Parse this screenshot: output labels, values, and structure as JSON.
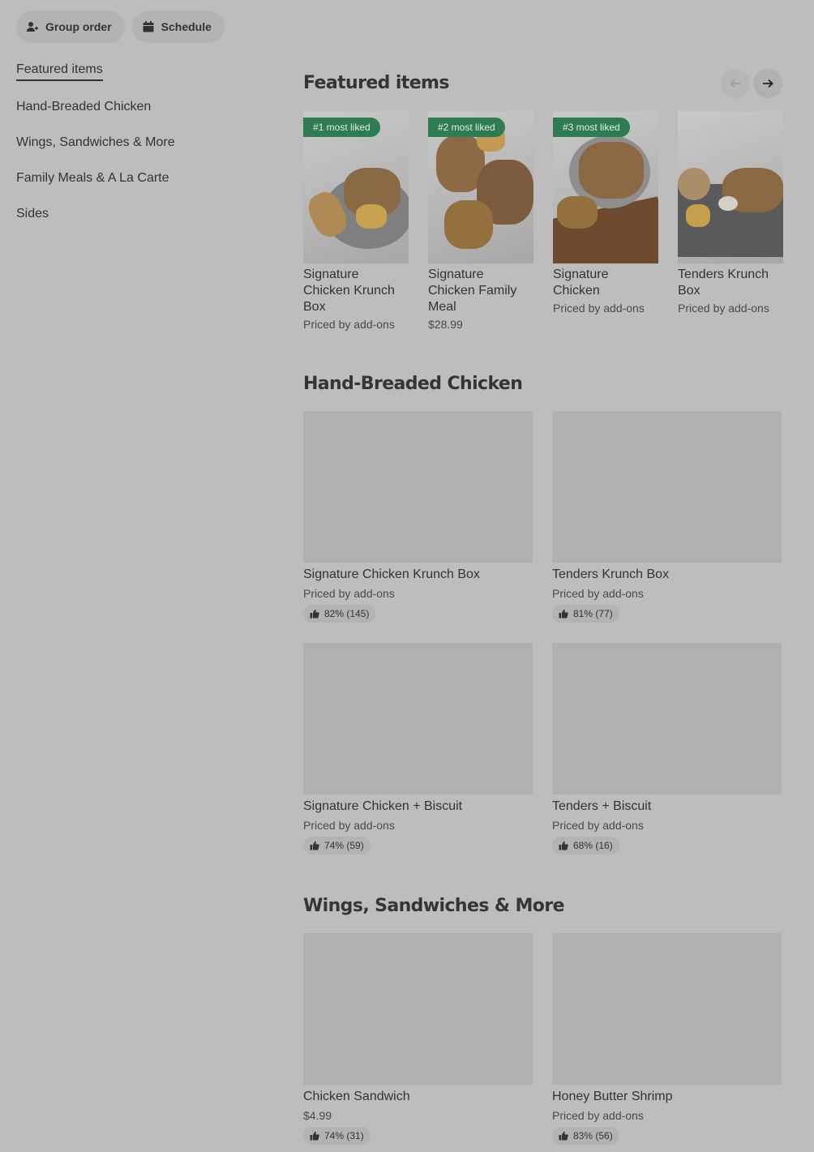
{
  "top_actions": {
    "group_order": "Group order",
    "schedule": "Schedule"
  },
  "side_nav": {
    "items": [
      {
        "label": "Featured items"
      },
      {
        "label": "Hand-Breaded Chicken"
      },
      {
        "label": "Wings, Sandwiches & More"
      },
      {
        "label": "Family Meals & A La Carte"
      },
      {
        "label": "Sides"
      }
    ]
  },
  "featured": {
    "title": "Featured items",
    "items": [
      {
        "badge": "#1 most liked",
        "name": "Signature Chicken Krunch Box",
        "price": "Priced by add-ons"
      },
      {
        "badge": "#2 most liked",
        "name": "Signature Chicken Family Meal",
        "price": "$28.99"
      },
      {
        "badge": "#3 most liked",
        "name": "Signature Chicken",
        "price": "Priced by add-ons"
      },
      {
        "badge": "",
        "name": "Tenders Krunch Box",
        "price": "Priced by add-ons"
      }
    ]
  },
  "hand_breaded": {
    "title": "Hand-Breaded Chicken",
    "items": [
      {
        "name": "Signature Chicken Krunch Box",
        "price": "Priced by add-ons",
        "rating": "82% (145)"
      },
      {
        "name": "Tenders Krunch Box",
        "price": "Priced by add-ons",
        "rating": "81% (77)"
      },
      {
        "name": "Signature Chicken + Biscuit",
        "price": "Priced by add-ons",
        "rating": "74% (59)"
      },
      {
        "name": "Tenders + Biscuit",
        "price": "Priced by add-ons",
        "rating": "68% (16)"
      }
    ]
  },
  "wings": {
    "title": "Wings, Sandwiches & More",
    "items": [
      {
        "name": "Chicken Sandwich",
        "price": "$4.99",
        "rating": "74% (31)"
      },
      {
        "name": "Honey Butter Shrimp",
        "price": "Priced by add-ons",
        "rating": "83% (56)"
      }
    ]
  },
  "colors": {
    "badge_green": "#2e7d52",
    "overlay_gray": "#bdbdbd"
  }
}
